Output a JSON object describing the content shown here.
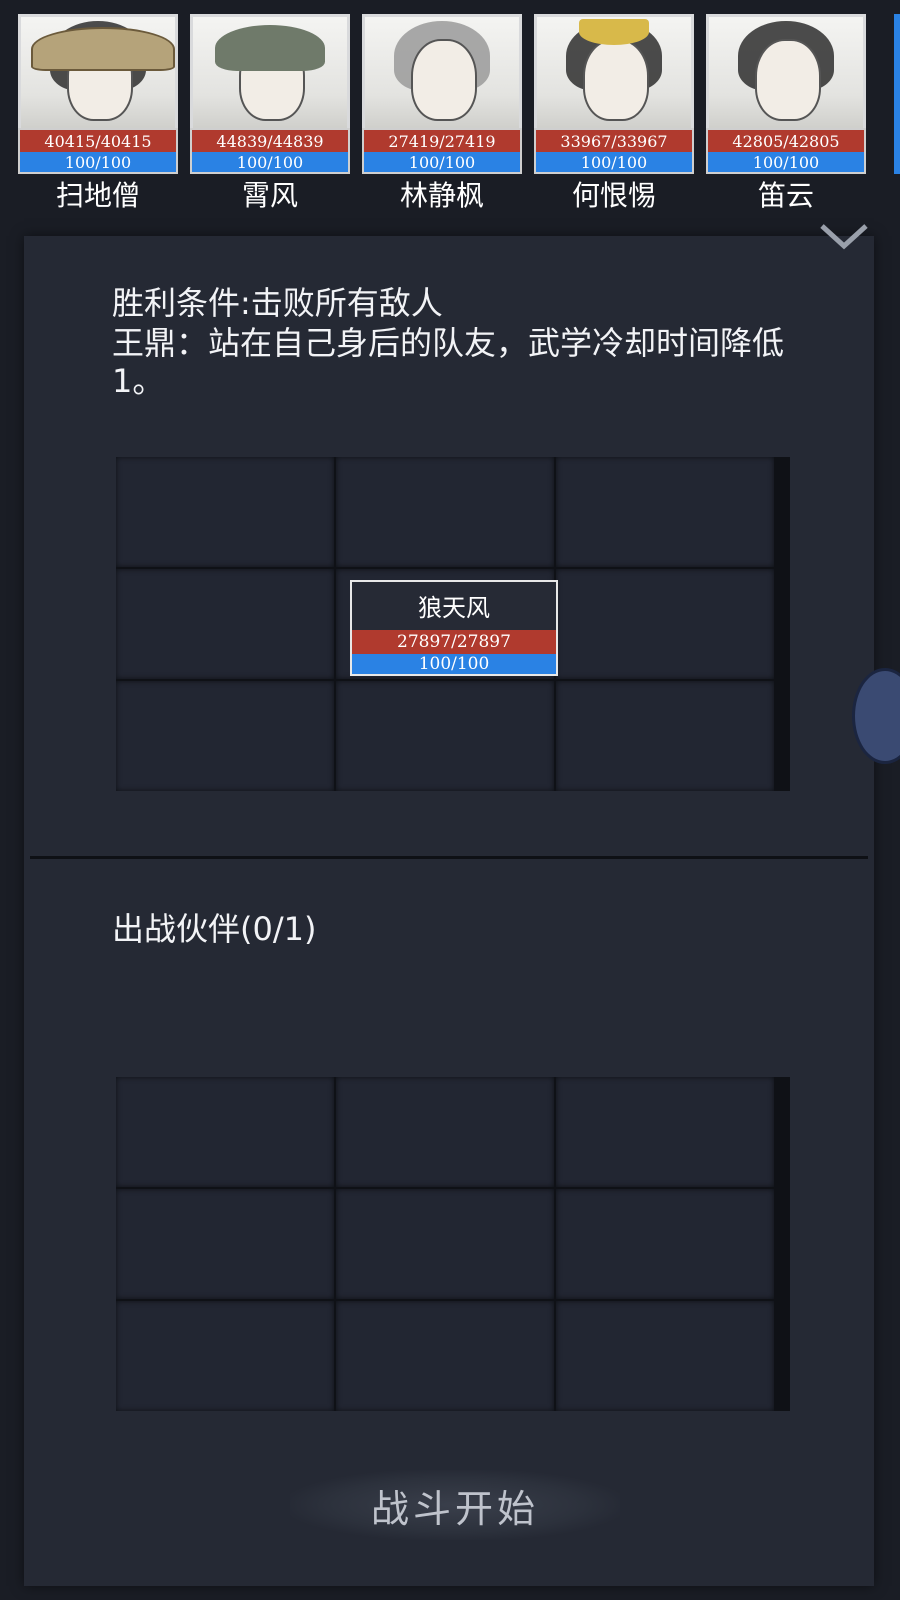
{
  "roster": [
    {
      "name": "扫地僧",
      "hp": "40415/40415",
      "mp": "100/100",
      "art": "hat"
    },
    {
      "name": "霄风",
      "hp": "44839/44839",
      "mp": "100/100",
      "art": "cap"
    },
    {
      "name": "林静枫",
      "hp": "27419/27419",
      "mp": "100/100",
      "art": "hair"
    },
    {
      "name": "何恨惕",
      "hp": "33967/33967",
      "mp": "100/100",
      "art": "crown"
    },
    {
      "name": "笛云",
      "hp": "42805/42805",
      "mp": "100/100",
      "art": "hair"
    }
  ],
  "battle": {
    "victory_condition": "胜利条件:击败所有敌人",
    "tip": "王鼎：站在自己身后的队友，武学冷却时间降低1。"
  },
  "enemy": {
    "name": "狼天风",
    "hp": "27897/27897",
    "mp": "100/100"
  },
  "allies": {
    "title": "出战伙伴(0/1)"
  },
  "actions": {
    "start_label": "战斗开始"
  },
  "colors": {
    "hp_bar": "#b03a2e",
    "mp_bar": "#2a82e4",
    "panel": "#252934"
  }
}
